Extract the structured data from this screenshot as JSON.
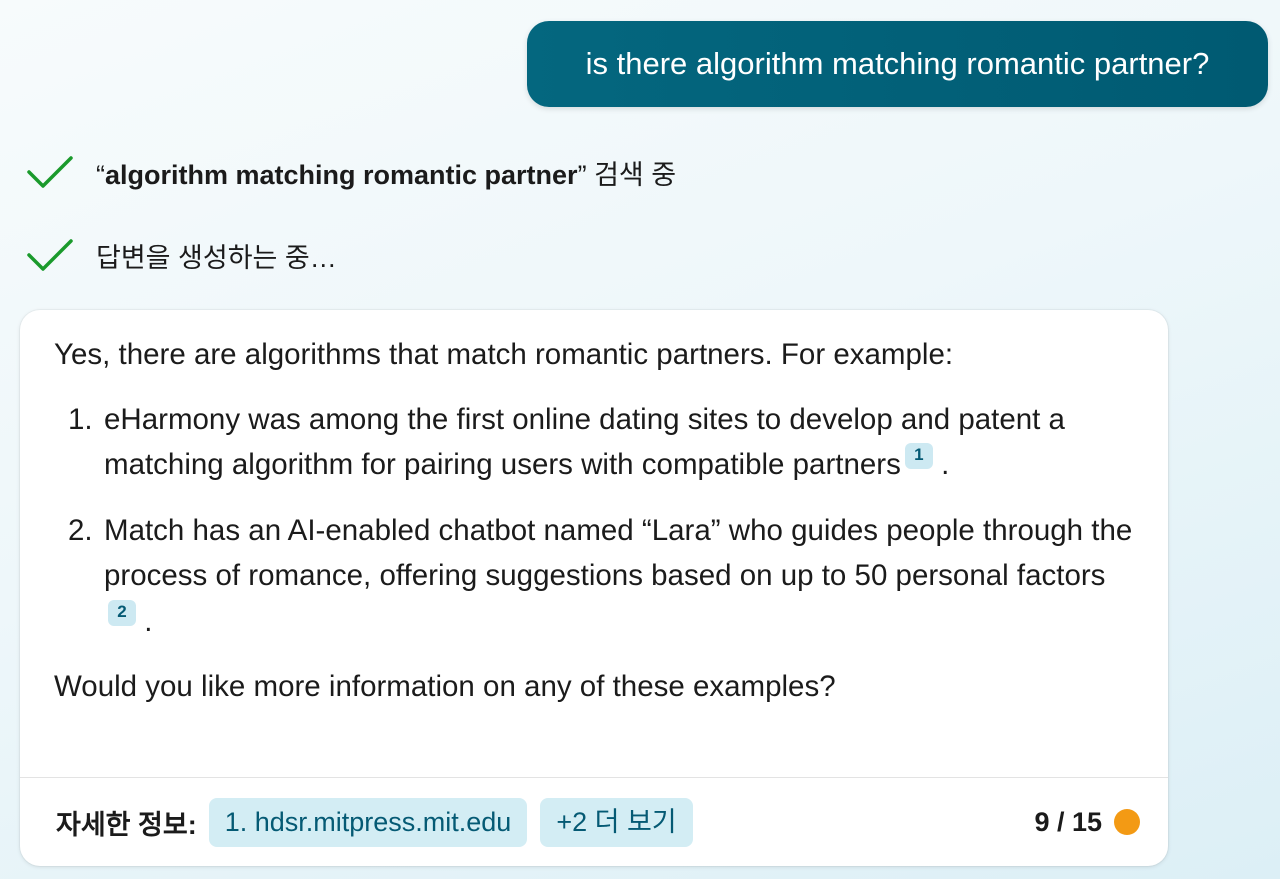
{
  "user_message": "is there algorithm matching romantic partner?",
  "steps": [
    {
      "open_quote": "“",
      "query": "algorithm matching romantic partner",
      "close_quote": "”",
      "suffix": " 검색 중",
      "icon": "check-icon"
    },
    {
      "text": "답변을 생성하는 중…",
      "icon": "check-icon"
    }
  ],
  "answer": {
    "intro": "Yes, there are algorithms that match romantic partners. For example:",
    "items": [
      {
        "num": "1.",
        "text": "eHarmony was among the first online dating sites to develop and patent a matching algorithm for pairing users with compatible partners",
        "cite": "1",
        "end": "."
      },
      {
        "num": "2.",
        "text": "Match has an AI-enabled chatbot named “Lara” who guides people through the process of romance, offering suggestions based on up to 50 personal factors",
        "cite": "2",
        "end": "."
      }
    ],
    "outro": "Would you like more information on any of these examples?"
  },
  "footer": {
    "label": "자세한 정보:",
    "sources": [
      "1. hdsr.mitpress.mit.edu",
      "+2 더 보기"
    ],
    "counter": "9 / 15"
  },
  "colors": {
    "user_bubble": "#04677f",
    "check": "#1a9a2c",
    "citation_bg": "#cde9f2",
    "status_dot": "#f39a14"
  }
}
